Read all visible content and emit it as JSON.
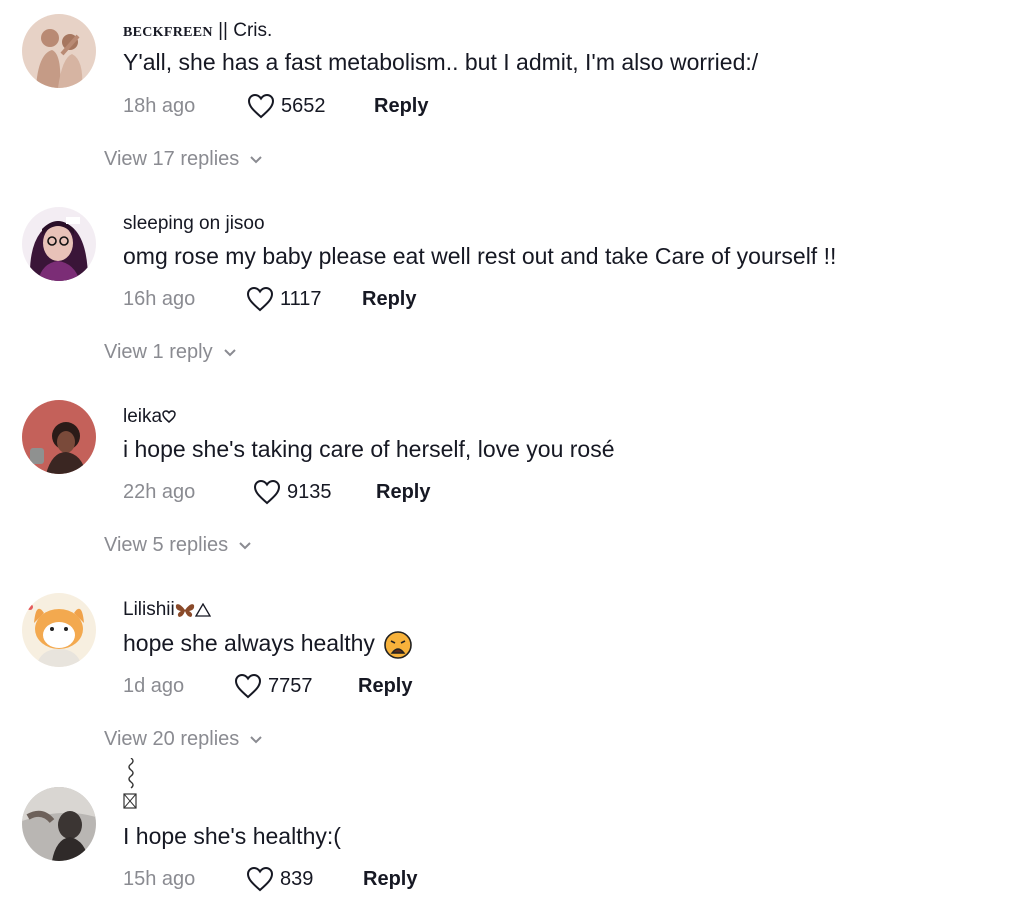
{
  "comments": [
    {
      "username_prefix": "BECKFREEN",
      "username_suffix": "|| Cris.",
      "text": "Y'all, she has a fast metabolism.. but I admit, I'm also worried:/",
      "time": "18h ago",
      "likes": "5652",
      "reply_label": "Reply",
      "view_replies": "View 17 replies"
    },
    {
      "username": "sleeping on jisoo",
      "text": "omg rose my baby please eat well rest out and take Care of yourself !!",
      "time": "16h ago",
      "likes": "1117",
      "reply_label": "Reply",
      "view_replies": "View 1 reply"
    },
    {
      "username": "leika",
      "text": "i hope she's taking care of herself, love you rosé",
      "time": "22h ago",
      "likes": "9135",
      "reply_label": "Reply",
      "view_replies": "View 5 replies"
    },
    {
      "username": "Lilishii",
      "text": "hope she always healthy",
      "time": "1d ago",
      "likes": "7757",
      "reply_label": "Reply",
      "view_replies": "View 20 replies"
    },
    {
      "username": "",
      "text": "I hope she's healthy:(",
      "time": "15h ago",
      "likes": "839",
      "reply_label": "Reply"
    }
  ],
  "icons": {
    "like": "heart-outline-icon",
    "expand": "chevron-down-icon",
    "emoji": "weary-face-emoji"
  },
  "colors": {
    "primary_text": "#161823",
    "secondary_text": "#8a8b91",
    "background": "#ffffff"
  }
}
